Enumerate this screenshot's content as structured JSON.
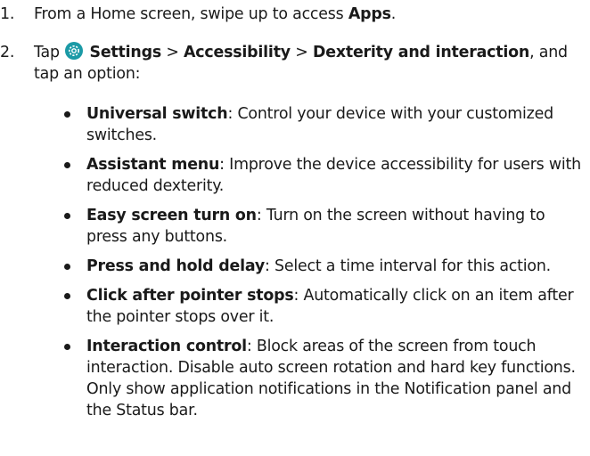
{
  "steps": [
    {
      "number": "1.",
      "prefix": "From a Home screen, swipe up to access ",
      "bold": "Apps",
      "suffix": "."
    },
    {
      "number": "2.",
      "tap": "Tap",
      "settings_icon": "settings-gear-icon",
      "settings_label": "Settings",
      "sep1": " > ",
      "accessibility_label": "Accessibility",
      "sep2": " > ",
      "dexterity_label": "Dexterity and interaction",
      "suffix": ", and tap an option:"
    }
  ],
  "options": [
    {
      "term": "Universal switch",
      "desc": ": Control your device with your customized switches."
    },
    {
      "term": "Assistant menu",
      "desc": ": Improve the device accessibility for users with reduced dexterity."
    },
    {
      "term": "Easy screen turn on",
      "desc": ": Turn on the screen without having to press any buttons."
    },
    {
      "term": "Press and hold delay",
      "desc": ": Select a time interval for this action."
    },
    {
      "term": "Click after pointer stops",
      "desc": ": Automatically click on an item after the pointer stops over it."
    },
    {
      "term": "Interaction control",
      "desc": ": Block areas of the screen from touch interaction. Disable auto screen rotation and hard key functions. Only show application notifications in the Notification panel and the Status bar."
    }
  ],
  "colors": {
    "text": "#1a1a1a",
    "settings_icon_bg": "#1b9aa6"
  }
}
